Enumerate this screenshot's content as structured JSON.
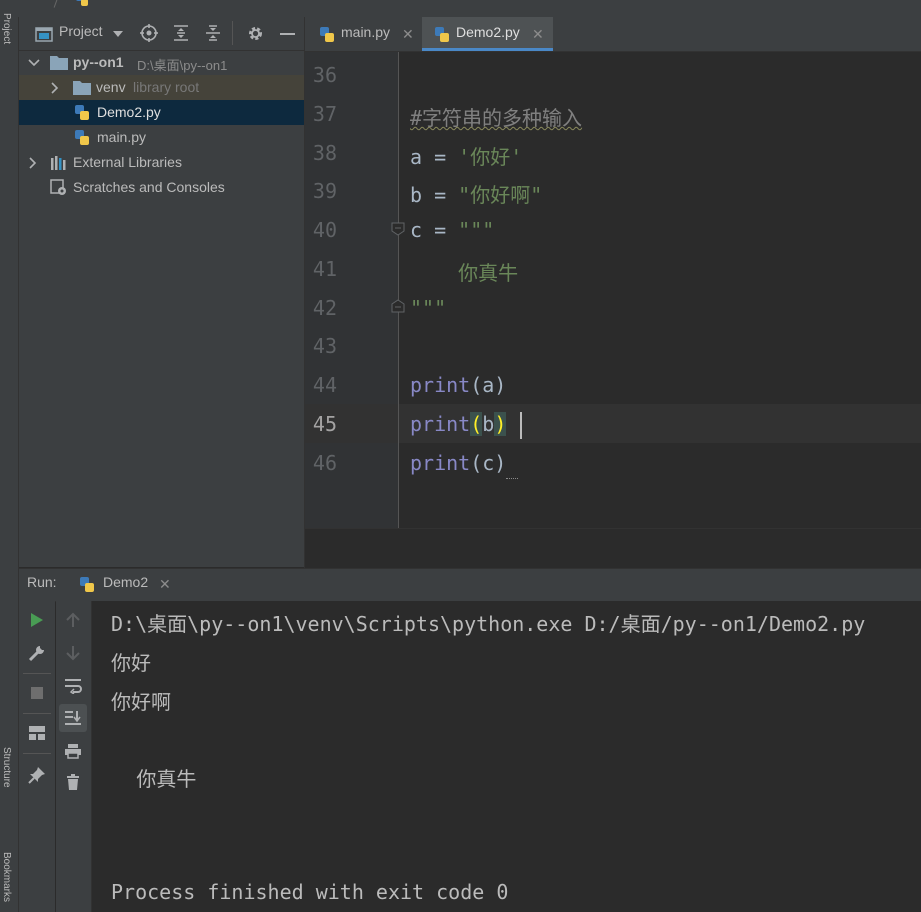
{
  "colors": {
    "background": "#2b2b2b",
    "panel": "#3c3f41",
    "selection": "#0d293e",
    "keyword": "#8888c6",
    "string": "#6a8759",
    "comment": "#808080",
    "run_green": "#499c54",
    "tab_active_underline": "#4a88c7"
  },
  "sidebar": {
    "project_label": "Project",
    "structure_label": "Structure",
    "bookmarks_label": "Bookmarks"
  },
  "project_panel": {
    "title": "Project",
    "tree": [
      {
        "name": "py--on1",
        "detail": "D:\\桌面\\py--on1",
        "type": "folder",
        "expanded": true
      },
      {
        "name": "venv",
        "detail": "library root",
        "type": "folder",
        "expanded": false
      },
      {
        "name": "Demo2.py",
        "type": "python-file",
        "selected": true
      },
      {
        "name": "main.py",
        "type": "python-file"
      },
      {
        "name": "External Libraries",
        "type": "libraries",
        "expanded": false
      },
      {
        "name": "Scratches and Consoles",
        "type": "scratches"
      }
    ]
  },
  "editor": {
    "tabs": [
      {
        "label": "main.py",
        "active": false
      },
      {
        "label": "Demo2.py",
        "active": true
      }
    ],
    "line_numbers": [
      "36",
      "37",
      "38",
      "39",
      "40",
      "41",
      "42",
      "43",
      "44",
      "45",
      "46"
    ],
    "current_line": "45",
    "lines": {
      "l37_comment": "#字符串的多种输入",
      "l38_var": "a",
      "l38_op": " = ",
      "l38_str": "'你好'",
      "l39_var": "b",
      "l39_op": " = ",
      "l39_str": "\"你好啊\"",
      "l40_var": "c",
      "l40_op": " = ",
      "l40_str": "\"\"\"",
      "l41_str": "    你真牛",
      "l42_str": "\"\"\"",
      "l44_kw": "print",
      "l44_args": "(a)",
      "l45_kw": "print",
      "l45_open": "(",
      "l45_arg": "b",
      "l45_close": ")",
      "l46_kw": "print",
      "l46_args": "(c)"
    }
  },
  "run_panel": {
    "label": "Run:",
    "tab": "Demo2",
    "console": [
      "D:\\桌面\\py--on1\\venv\\Scripts\\python.exe D:/桌面/py--on1/Demo2.py",
      "你好",
      "你好啊",
      "",
      "    你真牛",
      "",
      "",
      "Process finished with exit code 0"
    ]
  }
}
